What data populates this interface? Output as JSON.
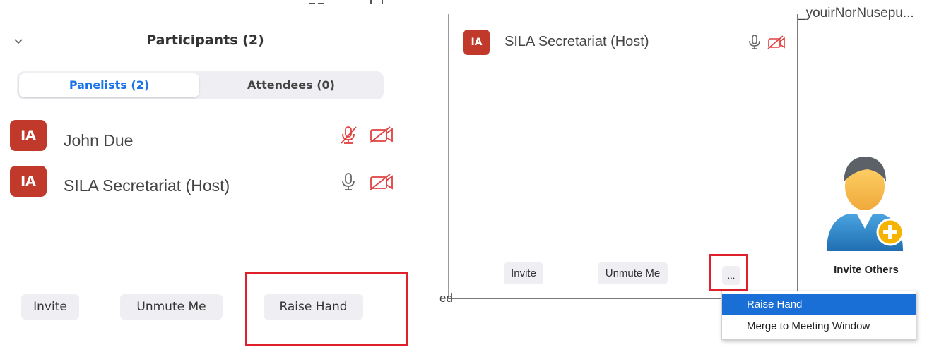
{
  "left_panel": {
    "title": "Participants (2)",
    "tabs": [
      {
        "label": "Panelists (2)",
        "active": true
      },
      {
        "label": "Attendees (0)",
        "active": false
      }
    ],
    "participants": [
      {
        "initials": "IA",
        "name": "John Due",
        "mic": "mic-muted-icon",
        "video": "video-off-icon"
      },
      {
        "initials": "IA",
        "name": "SILA Secretariat (Host)",
        "mic": "mic-icon",
        "video": "video-off-icon"
      }
    ],
    "buttons": {
      "invite": "Invite",
      "unmute": "Unmute Me",
      "raise_hand": "Raise Hand"
    }
  },
  "right_window": {
    "participant": {
      "initials": "IA",
      "name": "SILA Secretariat (Host)"
    },
    "buttons": {
      "invite": "Invite",
      "unmute": "Unmute Me",
      "more": "..."
    },
    "context_menu": [
      "Raise Hand",
      "Merge to Meeting Window"
    ],
    "side_text": "_youirNorNusepu...",
    "edge_text": "ed",
    "invite_others": "Invite Others"
  },
  "colors": {
    "accent_blue": "#1a73e8",
    "avatar_red": "#c0392b",
    "highlight_red": "#e0202a",
    "icon_red": "#e04040"
  }
}
